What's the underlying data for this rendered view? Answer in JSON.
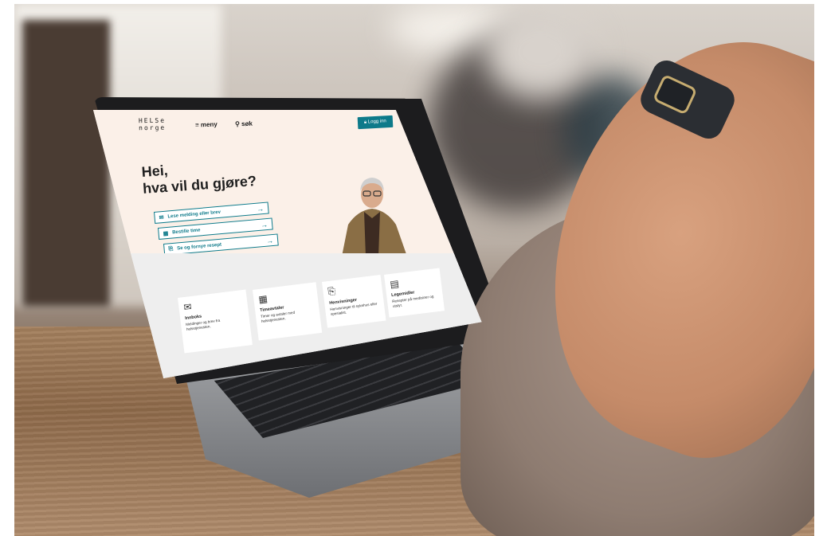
{
  "site": {
    "logo_line1": "HELSe",
    "logo_line2": "norge",
    "menu_label": "meny",
    "search_label": "søk",
    "login_label": "Logg inn"
  },
  "hero": {
    "title_line1": "Hei,",
    "title_line2": "hva vil du gjøre?",
    "actions": [
      {
        "label": "Lese melding eller brev",
        "icon": "envelope-icon"
      },
      {
        "label": "Bestille time",
        "icon": "calendar-icon"
      },
      {
        "label": "Se og fornye resept",
        "icon": "prescription-icon"
      }
    ]
  },
  "cards": [
    {
      "title": "Innboks",
      "desc": "Meldinger og brev fra helsetjenesten.",
      "icon": "envelope-icon"
    },
    {
      "title": "Timeavtaler",
      "desc": "Timer og avtaler med helsetjenesten.",
      "icon": "calendar-icon"
    },
    {
      "title": "Henvisninger",
      "desc": "Henvisninger til sykehus eller spesialist.",
      "icon": "referral-icon"
    },
    {
      "title": "Legemidler",
      "desc": "Resepter på medisiner og utstyr.",
      "icon": "medicine-icon"
    }
  ],
  "colors": {
    "accent": "#0d7a8a",
    "hero_bg": "#fbf0e8"
  }
}
